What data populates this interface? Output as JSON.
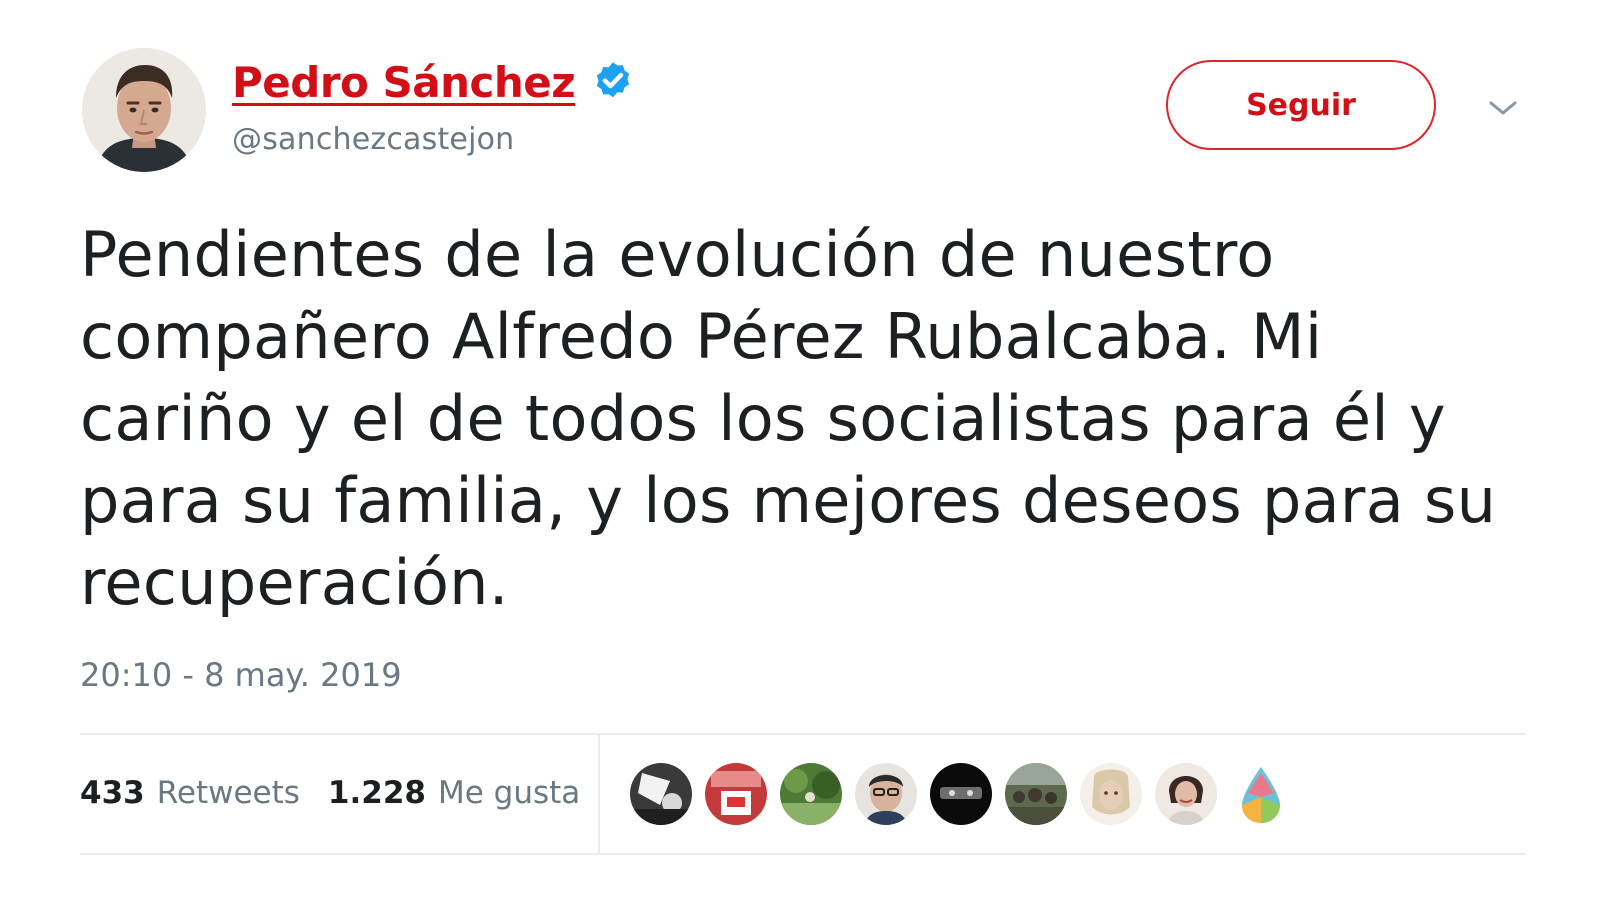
{
  "author": {
    "name": "Pedro Sánchez",
    "handle": "@sanchezcastejon",
    "verified": true,
    "avatar_icon": "profile-photo"
  },
  "follow_button": {
    "label": "Seguir",
    "color": "#d20f17"
  },
  "menu": {
    "icon": "chevron-down-icon"
  },
  "tweet": {
    "text_lines": [
      "Pendientes de la evolución de nuestro",
      "compañero Alfredo Pérez Rubalcaba. Mi",
      "cariño y el de todos los socialistas para él y",
      "para su familia, y los mejores deseos para su",
      "recuperación."
    ],
    "timestamp": "20:10 - 8 may. 2019"
  },
  "stats": {
    "retweets": {
      "count": "433",
      "label": "Retweets"
    },
    "likes": {
      "count": "1.228",
      "label": "Me gusta"
    }
  },
  "likers": [
    {
      "icon": "liker-avatar-1",
      "color": "#3a3a3a"
    },
    {
      "icon": "liker-avatar-2",
      "color": "#c23a3a"
    },
    {
      "icon": "liker-avatar-3",
      "color": "#4f7a35"
    },
    {
      "icon": "liker-avatar-4",
      "color": "#b8a48e"
    },
    {
      "icon": "liker-avatar-5",
      "color": "#0b0b0b"
    },
    {
      "icon": "liker-avatar-6",
      "color": "#5d6a4e"
    },
    {
      "icon": "liker-avatar-7",
      "color": "#d9cfc0"
    },
    {
      "icon": "liker-avatar-8",
      "color": "#efe8e3"
    },
    {
      "icon": "liker-avatar-9",
      "color": "#6cc0d8"
    }
  ],
  "colors": {
    "brand_red": "#d20f17",
    "verified_blue": "#1da1f2",
    "secondary_text": "#697882",
    "divider": "#e6ecf0"
  }
}
